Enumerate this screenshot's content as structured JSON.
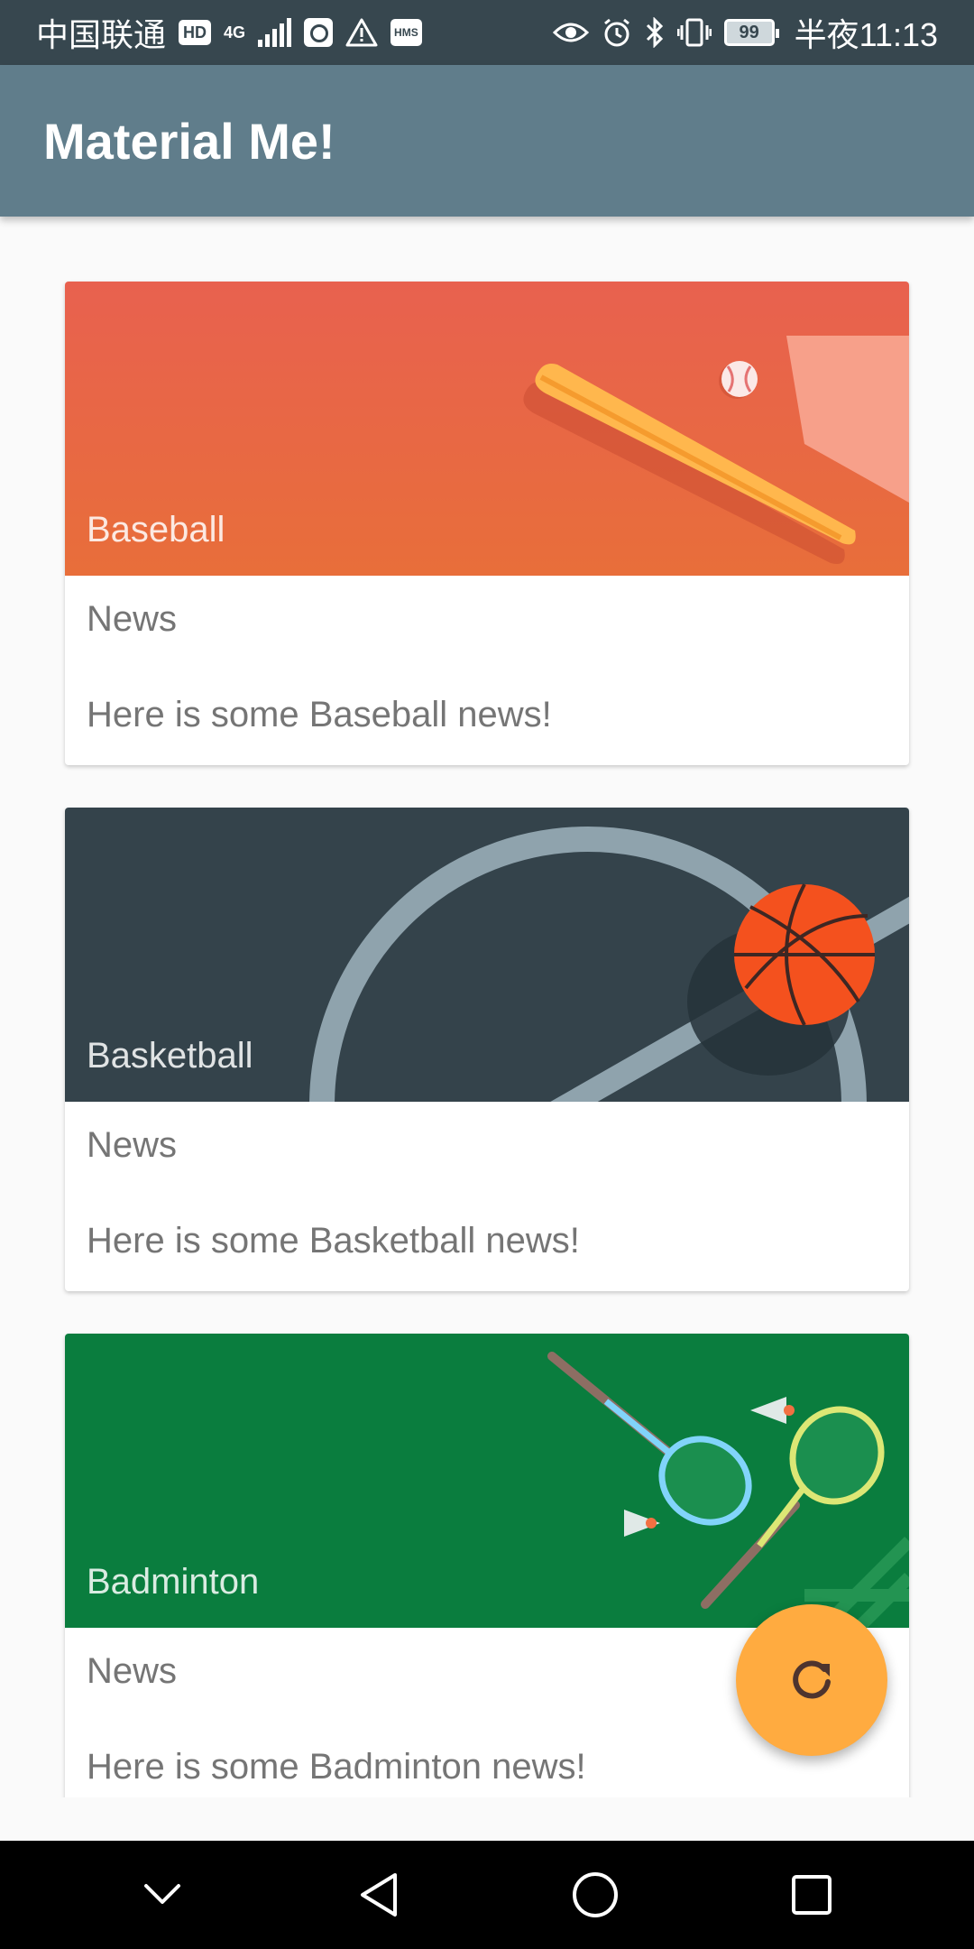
{
  "status_bar": {
    "carrier": "中国联通",
    "hd_badge": "HD",
    "network": "4G",
    "hms_badge": "HMS",
    "battery": "99",
    "time": "半夜11:13"
  },
  "app_bar": {
    "title": "Material Me!"
  },
  "cards": [
    {
      "title": "Baseball",
      "subtitle": "News",
      "info": "Here is some Baseball news!",
      "image_icon": "baseball-bat-icon",
      "bg_color": "#e8614f"
    },
    {
      "title": "Basketball",
      "subtitle": "News",
      "info": "Here is some Basketball news!",
      "image_icon": "basketball-icon",
      "bg_color": "#34434b"
    },
    {
      "title": "Badminton",
      "subtitle": "News",
      "info": "Here is some Badminton news!",
      "image_icon": "badminton-racket-icon",
      "bg_color": "#0a7d3e"
    }
  ],
  "fab": {
    "icon": "refresh-icon",
    "color": "#ffab40"
  },
  "nav_bar": {
    "icons": [
      "chevron-down-icon",
      "back-icon",
      "home-icon",
      "recents-icon"
    ]
  },
  "colors": {
    "status_bar": "#37474f",
    "app_bar": "#607d8b",
    "background": "#fafafa"
  }
}
